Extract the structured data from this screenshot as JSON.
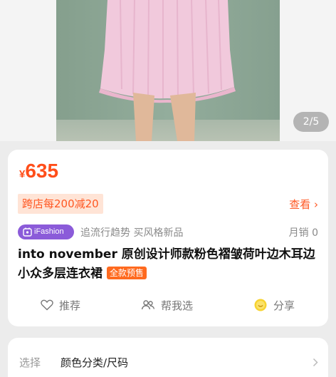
{
  "gallery": {
    "page_indicator": "2/5"
  },
  "product": {
    "currency_symbol": "¥",
    "price": "635",
    "promo_tag": "跨店每200减20",
    "view_label": "查看 ›",
    "brand_badge": "iFashion",
    "slogan": "追流行趋势 买风格新品",
    "monthly_sales": "月销 0",
    "title": "into november 原创设计师款粉色褶皱荷叶边木耳边小众多层连衣裙",
    "presale_tag": "全款预售"
  },
  "actions": {
    "recommend": "推荐",
    "help_choose": "帮我选",
    "share": "分享"
  },
  "spec": {
    "label": "选择",
    "value": "颜色分类/尺码"
  },
  "colors": {
    "accent": "#ff4e1a",
    "promo_bg": "#ffe4d6",
    "ifashion_purple": "#8b5bd9",
    "presale_orange": "#ff6a1f"
  },
  "icons": {
    "recommend": "heart-outline-icon",
    "help_choose": "people-icon",
    "share": "yellow-smiley-coin-icon",
    "chevron": "chevron-right-icon"
  }
}
